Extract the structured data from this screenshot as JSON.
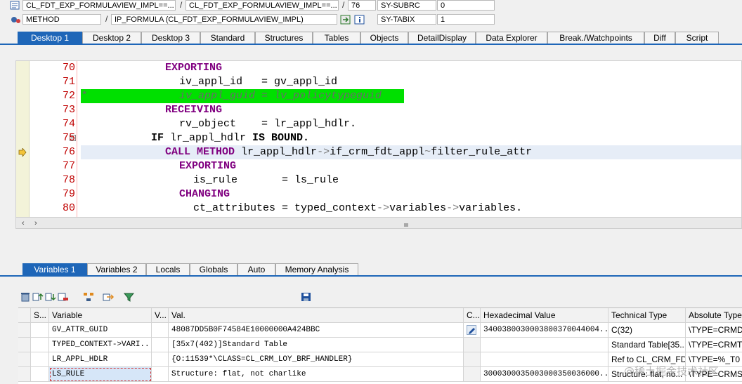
{
  "top": {
    "row1": {
      "class_field": "CL_FDT_EXP_FORMULAVIEW_IMPL==...",
      "sep1": "/",
      "include_field": "CL_FDT_EXP_FORMULAVIEW_IMPL==...",
      "sep2": "/",
      "line_field": "76",
      "sysfield_name": "SY-SUBRC",
      "sysfield_value": "0"
    },
    "row2": {
      "kind_field": "METHOD",
      "sep1": "/",
      "method_field": "IP_FORMULA (CL_FDT_EXP_FORMULAVIEW_IMPL)",
      "sysfield_name": "SY-TABIX",
      "sysfield_value": "1"
    }
  },
  "desktop_tabs": [
    "Desktop 1",
    "Desktop 2",
    "Desktop 3",
    "Standard",
    "Structures",
    "Tables",
    "Objects",
    "DetailDisplay",
    "Data Explorer",
    "Break./Watchpoints",
    "Diff",
    "Script"
  ],
  "code": {
    "lines": [
      {
        "num": "70"
      },
      {
        "num": "71"
      },
      {
        "num": "72"
      },
      {
        "num": "73"
      },
      {
        "num": "74"
      },
      {
        "num": "75"
      },
      {
        "num": "76"
      },
      {
        "num": "77"
      },
      {
        "num": "78"
      },
      {
        "num": "79"
      },
      {
        "num": "80"
      }
    ],
    "t70_kw": "EXPORTING",
    "t71_a": "iv_appl_id",
    "t71_b": "   = gv_appl_id",
    "t72_star": "*",
    "t72_text": "iv_appl_guid = lv_policytypeguid",
    "t73_kw": "RECEIVING",
    "t74_a": "rv_object",
    "t74_b": "    = lr_appl_hdlr.",
    "t75_if": "IF",
    "t75_mid": " lr_appl_hdlr ",
    "t75_is": "IS BOUND.",
    "t76_kw": "CALL METHOD",
    "t76_a": " lr_appl_hdlr",
    "t76_arrow": "->",
    "t76_b": "if_crm_fdt_appl",
    "t76_tilde": "~",
    "t76_c": "filter_rule_attr",
    "t77_kw": "EXPORTING",
    "t78_a": "is_rule",
    "t78_b": "       = ls_rule",
    "t79_kw": "CHANGING",
    "t80_a": "ct_attributes = typed_context",
    "t80_arrow1": "->",
    "t80_b": "variables",
    "t80_arrow2": "->",
    "t80_c": "variables."
  },
  "var_tabs": [
    "Variables 1",
    "Variables 2",
    "Locals",
    "Globals",
    "Auto",
    "Memory Analysis"
  ],
  "grid": {
    "headers": {
      "s": "S...",
      "variable": "Variable",
      "v": "V...",
      "val": "Val.",
      "c": "C...",
      "hex": "Hexadecimal Value",
      "tech": "Technical Type",
      "abs": "Absolute Type"
    },
    "rows": [
      {
        "variable": "GV_ATTR_GUID",
        "val": "48087DD5B0F74584E10000000A424BBC",
        "hex": "3400380030003800370044004...",
        "tech": "C(32)",
        "abs": "\\TYPE=CRMDT"
      },
      {
        "variable": "TYPED_CONTEXT->VARI...",
        "val": "[35x7(402)]Standard Table",
        "hex": "",
        "tech": "Standard Table[35...",
        "abs": "\\TYPE=CRMT_"
      },
      {
        "variable": "LR_APPL_HDLR",
        "val": "{O:11539*\\CLASS=CL_CRM_LOY_BRF_HANDLER}",
        "hex": "",
        "tech": "Ref to CL_CRM_FD...",
        "abs": "\\TYPE=%_T0"
      },
      {
        "variable": "LS_RULE",
        "val": "Structure: flat, not charlike",
        "hex": "3000300035003000350036000...",
        "tech": "Structure: flat, no...",
        "abs": "\\TYPE=CRMS"
      }
    ]
  },
  "watermark": "@稀土掘金技术社区",
  "colors": {
    "accent_tab": "#1e66b8",
    "keyword": "#800080",
    "line_numbers": "#c00000",
    "highlight_comment": "#00e000",
    "current_line": "#e6edf7"
  }
}
